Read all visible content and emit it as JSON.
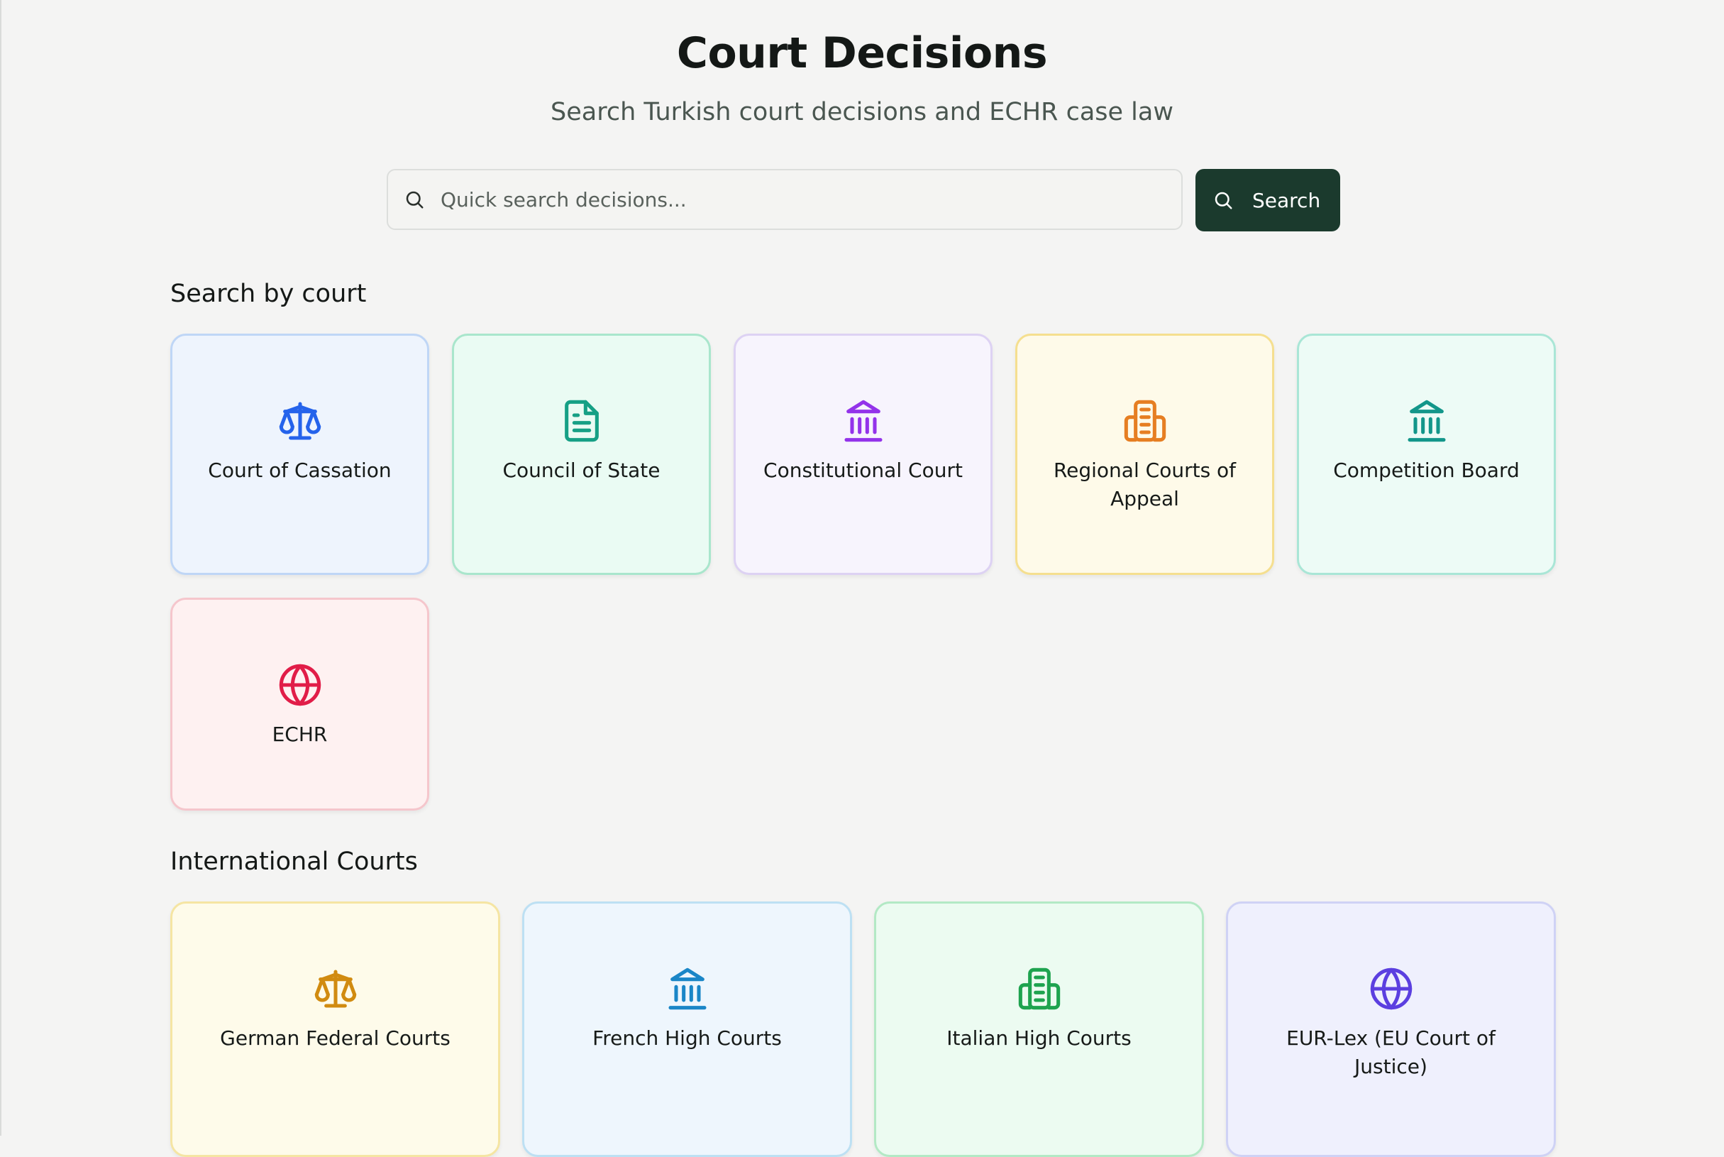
{
  "header": {
    "title": "Court Decisions",
    "subtitle": "Search Turkish court decisions and ECHR case law"
  },
  "search": {
    "placeholder": "Quick search decisions...",
    "value": "",
    "button_label": "Search",
    "button_color": "#1b3a2d"
  },
  "sections": {
    "by_court": {
      "heading": "Search by court",
      "cards": [
        {
          "label": "Court of Cassation",
          "icon": "scale-icon",
          "color": "#2563eb",
          "bg": "#eef4fd",
          "border": "#bfd6f6"
        },
        {
          "label": "Council of State",
          "icon": "document-icon",
          "color": "#16a085",
          "bg": "#eafbf3",
          "border": "#a9e6cc"
        },
        {
          "label": "Constitutional Court",
          "icon": "landmark-icon",
          "color": "#9333ea",
          "bg": "#f7f4fd",
          "border": "#ddd2f3"
        },
        {
          "label": "Regional Courts of Appeal",
          "icon": "building-icon",
          "color": "#e67e22",
          "bg": "#fefae9",
          "border": "#f5df8f"
        },
        {
          "label": "Competition Board",
          "icon": "landmark-icon",
          "color": "#13968a",
          "bg": "#edfbf6",
          "border": "#a9e6d6"
        },
        {
          "label": "ECHR",
          "icon": "globe-icon",
          "color": "#e11d48",
          "bg": "#fef1f1",
          "border": "#f5c6cc"
        }
      ]
    },
    "international": {
      "heading": "International Courts",
      "cards": [
        {
          "label": "German Federal Courts",
          "icon": "scale-icon",
          "color": "#d18b10",
          "bg": "#fefbea",
          "border": "#f5e5a3"
        },
        {
          "label": "French High Courts",
          "icon": "landmark-icon",
          "color": "#1a86c7",
          "bg": "#eef6fd",
          "border": "#bde0f3"
        },
        {
          "label": "Italian High Courts",
          "icon": "building-icon",
          "color": "#1ea34f",
          "bg": "#ecfbf1",
          "border": "#b3e9c5"
        },
        {
          "label": "EUR-Lex (EU Court of Justice)",
          "icon": "globe-icon",
          "color": "#5b3fe0",
          "bg": "#eff0fd",
          "border": "#cfd2f5"
        }
      ]
    }
  }
}
